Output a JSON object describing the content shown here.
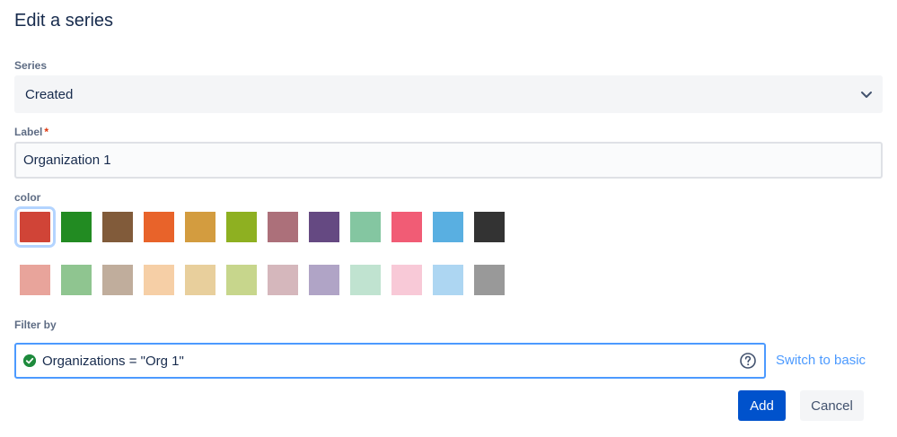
{
  "dialog": {
    "title": "Edit a series"
  },
  "series": {
    "label": "Series",
    "value": "Created"
  },
  "label_field": {
    "label": "Label",
    "required_marker": "*",
    "value": "Organization 1"
  },
  "color": {
    "label": "color",
    "selected": "#d04437",
    "row1": [
      "#d04437",
      "#228b22",
      "#815b3a",
      "#e8632a",
      "#d39c3f",
      "#8eb021",
      "#ac707a",
      "#654982",
      "#84c6a1",
      "#f15c75",
      "#59afe1",
      "#333333"
    ],
    "row2": [
      "#e8a49b",
      "#8fc590",
      "#c0ad9c",
      "#f6cfa6",
      "#e8cf9c",
      "#c7d68c",
      "#d5b7bc",
      "#b0a4c6",
      "#c0e3d0",
      "#f8c9d7",
      "#add6f2",
      "#999999"
    ]
  },
  "filter": {
    "label": "Filter by",
    "query": "Organizations = \"Org 1\"",
    "status_icon": "check-circle-icon",
    "help_icon": "question-circle-icon",
    "switch_label": "Switch to basic"
  },
  "actions": {
    "add_label": "Add",
    "cancel_label": "Cancel"
  }
}
